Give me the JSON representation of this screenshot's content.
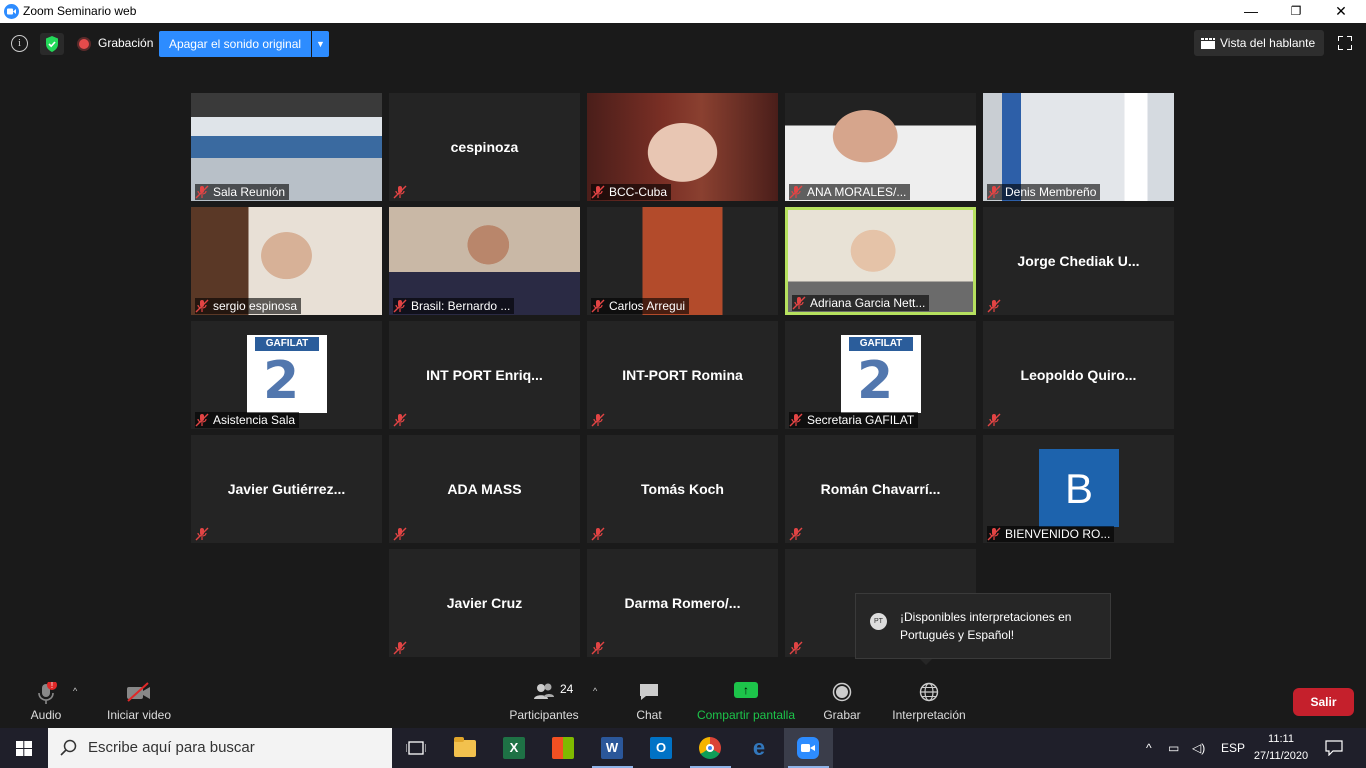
{
  "window": {
    "title": "Zoom Seminario web",
    "minimize": "—",
    "maximize": "❐",
    "close": "✕"
  },
  "topbar": {
    "recording_label": "Grabación",
    "original_sound_button": "Apagar el sonido original",
    "view_button": "Vista del hablante"
  },
  "tiles": [
    {
      "label": "Sala Reunión",
      "center": ""
    },
    {
      "label": "",
      "center": "cespinoza"
    },
    {
      "label": "BCC-Cuba",
      "center": ""
    },
    {
      "label": "ANA MORALES/...",
      "center": ""
    },
    {
      "label": "Denis Membreño",
      "center": ""
    },
    {
      "label": "sergio espinosa",
      "center": ""
    },
    {
      "label": "Brasil: Bernardo ...",
      "center": ""
    },
    {
      "label": "Carlos Arregui",
      "center": ""
    },
    {
      "label": "Adriana Garcia Nett...",
      "center": ""
    },
    {
      "label": "",
      "center": "Jorge  Chediak  U..."
    },
    {
      "label": "Asistencia Sala",
      "center": "",
      "logo": "GAFILAT"
    },
    {
      "label": "",
      "center": "INT PORT Enriq..."
    },
    {
      "label": "",
      "center": "INT-PORT Romina"
    },
    {
      "label": "Secretaria GAFILAT",
      "center": "",
      "logo": "GAFILAT"
    },
    {
      "label": "",
      "center": "Leopoldo  Quiro..."
    },
    {
      "label": "",
      "center": "Javier  Gutiérrez..."
    },
    {
      "label": "",
      "center": "ADA MASS"
    },
    {
      "label": "",
      "center": "Tomás Koch"
    },
    {
      "label": "",
      "center": "Román  Chavarrí..."
    },
    {
      "label": "BIENVENIDO RO...",
      "center": "",
      "avatar": "B"
    },
    {
      "label": "",
      "center": "Javier Cruz"
    },
    {
      "label": "",
      "center": "Darma  Romero/..."
    },
    {
      "label": "",
      "center": "Jo"
    }
  ],
  "toast": {
    "badge": "PT",
    "text": "¡Disponibles interpretaciones en Portugués y Español!"
  },
  "toolbar": {
    "audio": "Audio",
    "video": "Iniciar video",
    "participants": "Participantes",
    "participants_count": "24",
    "chat": "Chat",
    "share": "Compartir pantalla",
    "record": "Grabar",
    "interpretation": "Interpretación",
    "leave": "Salir"
  },
  "taskbar": {
    "search_placeholder": "Escribe aquí para buscar",
    "lang": "ESP",
    "time": "11:11",
    "date": "27/11/2020"
  }
}
